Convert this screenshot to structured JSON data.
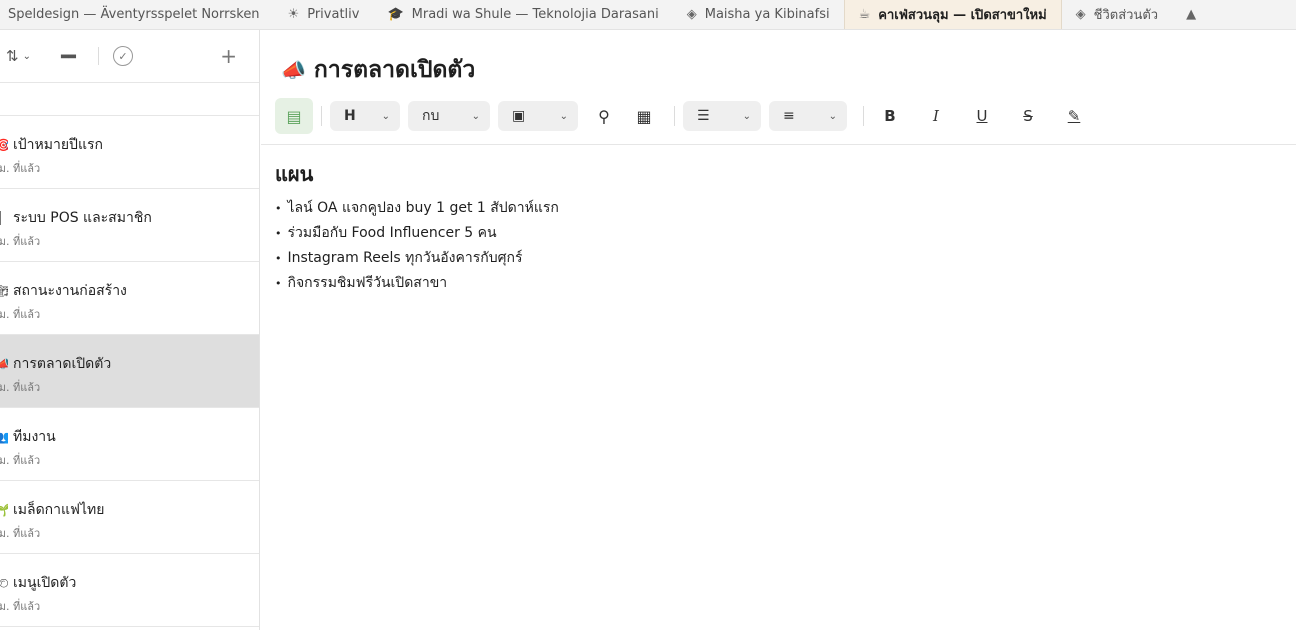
{
  "tabs": [
    {
      "label": "Speldesign — Äventyrsspelet Norrsken",
      "icon": ""
    },
    {
      "label": "Privatliv",
      "icon": "☀"
    },
    {
      "label": "Mradi wa Shule — Teknolojia Darasani",
      "icon": "🎓"
    },
    {
      "label": "Maisha ya Kibinafsi",
      "icon": "◈"
    },
    {
      "label": "คาเฟ่สวนลุม — เปิดสาขาใหม่",
      "icon": "☕",
      "active": true
    },
    {
      "label": "ชีวิตส่วนตัว",
      "icon": "◈"
    },
    {
      "label": "",
      "icon": "▲"
    }
  ],
  "sidebar": {
    "toolbar": {
      "sort": "⇅",
      "chevron": "⌄",
      "cards": "▬▬",
      "check": "✓",
      "add": "+"
    },
    "items": [
      {
        "icon": "🎯",
        "title": "เป้าหมายปีแรก",
        "sub": "ธม. ที่แล้ว"
      },
      {
        "icon": "▌",
        "title": "ระบบ POS และสมาชิก",
        "sub": "ธม. ที่แล้ว"
      },
      {
        "icon": "🏗",
        "title": "สถานะงานก่อสร้าง",
        "sub": "ธม. ที่แล้ว"
      },
      {
        "icon": "📣",
        "title": "การตลาดเปิดตัว",
        "sub": "ธม. ที่แล้ว",
        "selected": true
      },
      {
        "icon": "👥",
        "title": "ทีมงาน",
        "sub": "ธม. ที่แล้ว"
      },
      {
        "icon": "🌱",
        "title": "เมล็ดกาแฟไทย",
        "sub": "ธม. ที่แล้ว"
      },
      {
        "icon": "🍽",
        "title": "เมนูเปิดตัว",
        "sub": "ธม. ที่แล้ว"
      }
    ]
  },
  "editor": {
    "title_icon": "📣",
    "title": "การตลาดเปิดตัว",
    "toolbar": {
      "doc_icon": "▤",
      "heading_label": "H",
      "text_label": "กบ",
      "image_icon": "▣",
      "attach_icon": "⚲",
      "table_icon": "▦",
      "quote_icon": "☰",
      "list_icon": "≡",
      "bold": "B",
      "italic": "I",
      "underline": "U",
      "strike": "S",
      "highlight": "✎",
      "chevron": "⌄"
    },
    "heading": "แผน",
    "bullets": [
      "ไลน์ OA แจกคูปอง buy 1 get 1 สัปดาห์แรก",
      "ร่วมมือกับ Food Influencer 5 คน",
      "Instagram Reels ทุกวันอังคารกับศุกร์",
      "กิจกรรมชิมฟรีวันเปิดสาขา"
    ]
  }
}
